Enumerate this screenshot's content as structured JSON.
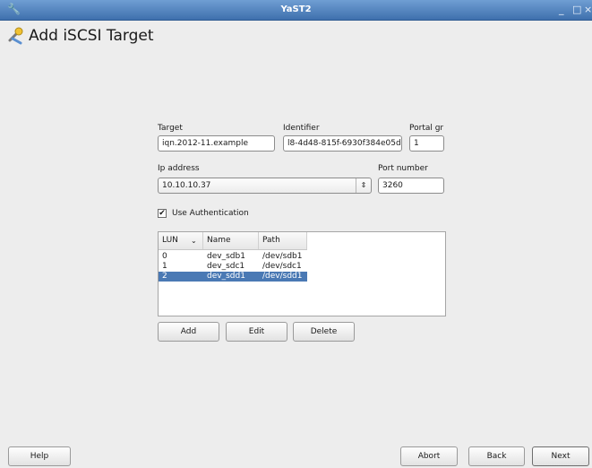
{
  "window": {
    "title": "YaST2",
    "icon": "wrench-icon",
    "controls": [
      "_",
      "□",
      "×"
    ]
  },
  "header": {
    "title": "Add iSCSI Target",
    "icon": "tools-icon"
  },
  "form": {
    "target_label": "Target",
    "target_value": "iqn.2012-11.example",
    "identifier_label": "Identifier",
    "identifier_value": "l8-4d48-815f-6930f384e05d",
    "portal_label": "Portal gr",
    "portal_value": "1",
    "ip_label": "Ip address",
    "ip_value": "10.10.10.37",
    "port_label": "Port number",
    "port_value": "3260",
    "auth_label": "Use Authentication",
    "auth_checked": true
  },
  "lun_table": {
    "columns": [
      "LUN",
      "Name",
      "Path"
    ],
    "rows": [
      {
        "lun": "0",
        "name": "dev_sdb1",
        "path": "/dev/sdb1"
      },
      {
        "lun": "1",
        "name": "dev_sdc1",
        "path": "/dev/sdc1"
      },
      {
        "lun": "2",
        "name": "dev_sdd1",
        "path": "/dev/sdd1"
      }
    ],
    "selected_row": 2
  },
  "table_buttons": {
    "add": "Add",
    "edit": "Edit",
    "delete": "Delete"
  },
  "footer": {
    "help": "Help",
    "abort": "Abort",
    "back": "Back",
    "next": "Next"
  }
}
